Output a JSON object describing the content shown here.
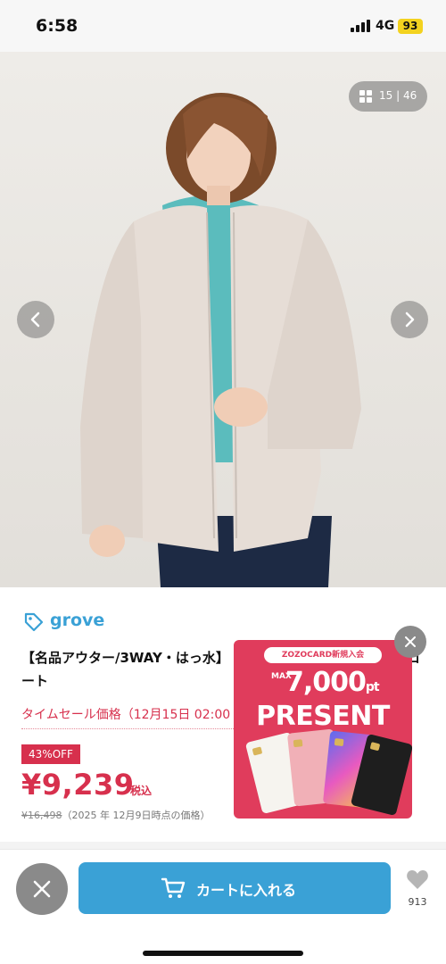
{
  "status_bar": {
    "time": "6:58",
    "network": "4G",
    "battery": "93"
  },
  "gallery": {
    "counter": "15 | 46"
  },
  "product": {
    "brand": "grove",
    "title": "【名品アウター/3WAY・はっ水】",
    "title_line2": "ート",
    "title_tail": "コ",
    "sale_label": "タイムセール価格（12月15日 02:00",
    "discount": "43%OFF",
    "price": "¥9,239",
    "tax_label": "税込",
    "original_price": "¥16,498",
    "price_note": "（2025 年 12月9日時点の価格）"
  },
  "promo": {
    "pill": "ZOZOCARD新規入会",
    "max": "MAX",
    "amount": "7,000",
    "unit": "pt",
    "present": "PRESENT"
  },
  "bottom_bar": {
    "cart_label": "カートに入れる",
    "favorites_count": "913"
  },
  "colors": {
    "accent": "#3aa1d6",
    "sale": "#d7304d",
    "promo_bg": "#e03c5c"
  }
}
